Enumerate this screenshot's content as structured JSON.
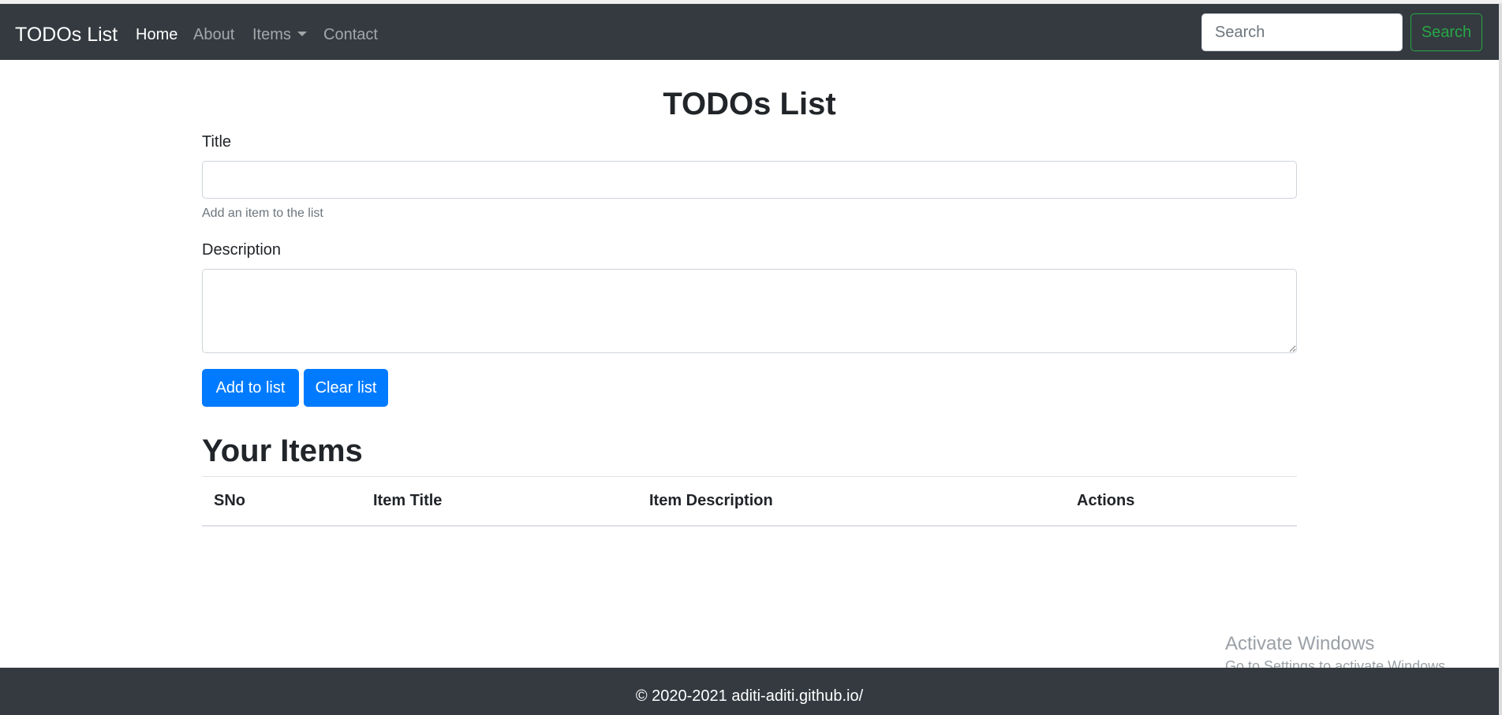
{
  "navbar": {
    "brand": "TODOs List",
    "links": [
      {
        "label": "Home",
        "active": true
      },
      {
        "label": "About",
        "active": false
      },
      {
        "label": "Items",
        "active": false,
        "dropdown": true
      },
      {
        "label": "Contact",
        "active": false
      }
    ],
    "search": {
      "placeholder": "Search",
      "value": "",
      "button_label": "Search"
    }
  },
  "main": {
    "heading": "TODOs List",
    "form": {
      "title_label": "Title",
      "title_value": "",
      "title_help": "Add an item to the list",
      "description_label": "Description",
      "description_value": "",
      "add_button": "Add to list",
      "clear_button": "Clear list"
    },
    "items_heading": "Your Items",
    "table": {
      "columns": [
        "SNo",
        "Item Title",
        "Item Description",
        "Actions"
      ],
      "rows": []
    }
  },
  "footer": {
    "copyright": "© 2020-2021 aditi-aditi.github.io/"
  },
  "watermark": {
    "title": "Activate Windows",
    "subtitle": "Go to Settings to activate Windows."
  },
  "colors": {
    "navbar_bg": "#343a40",
    "primary": "#007bff",
    "success": "#28a745",
    "text": "#212529",
    "muted": "#6c757d"
  }
}
